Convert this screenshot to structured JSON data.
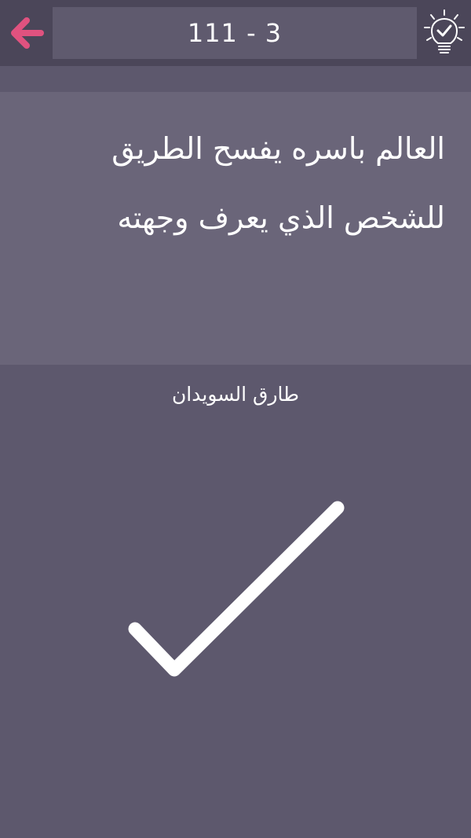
{
  "header": {
    "back_icon": "arrow-left-icon",
    "level_label": "111 - 3",
    "hint_icon": "lightbulb-check-icon"
  },
  "quote": {
    "line1": "العالم باسره يفسح الطريق",
    "line2": "للشخص الذي يعرف وجهته"
  },
  "author": "طارق السويدان",
  "result": {
    "icon": "checkmark-icon"
  },
  "colors": {
    "background": "#5d586d",
    "top_bar": "#4b4659",
    "level_box": "#5f5a6e",
    "quote_panel": "#6a6579",
    "back_arrow": "#e0527f",
    "text": "#ffffff"
  }
}
